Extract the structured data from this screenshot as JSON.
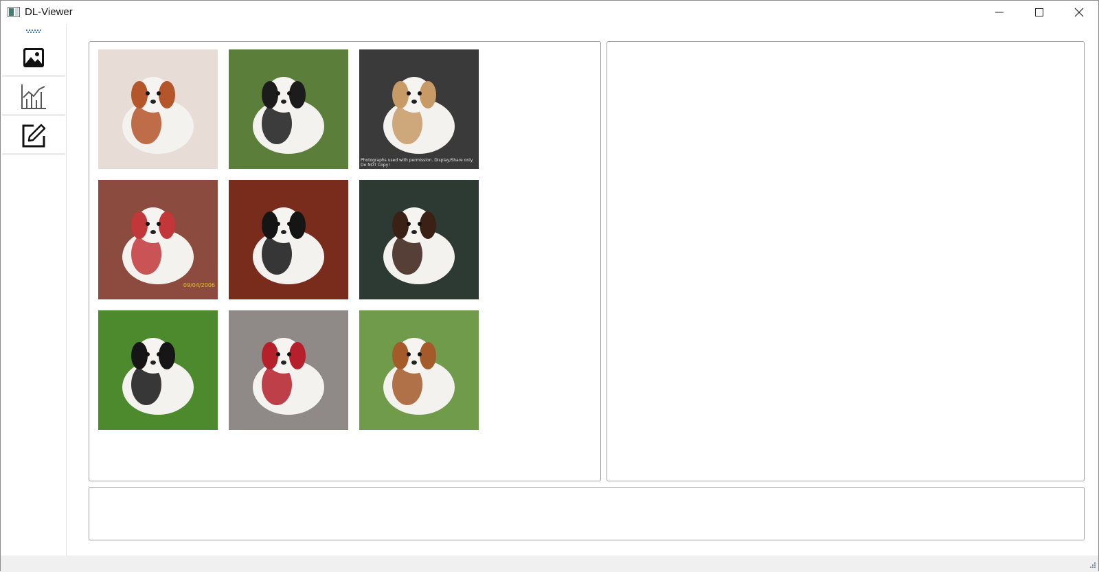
{
  "window": {
    "title": "DL-Viewer",
    "app_icon": "dl-viewer-app-icon",
    "controls": {
      "minimize_icon": "minimize-icon",
      "maximize_icon": "maximize-icon",
      "close_icon": "close-icon"
    }
  },
  "sidebar": {
    "grip_icon": "dotted-grip-icon",
    "items": [
      {
        "id": "images",
        "icon": "image-icon"
      },
      {
        "id": "statistics",
        "icon": "bar-line-chart-icon"
      },
      {
        "id": "edit",
        "icon": "edit-pencil-icon"
      }
    ]
  },
  "gallery": {
    "thumbnails": [
      {
        "subject": "dog-photo",
        "colors": [
          "#e8dcd6",
          "#b5552a"
        ]
      },
      {
        "subject": "dog-photo",
        "colors": [
          "#5b7f3b",
          "#1c1c1c"
        ]
      },
      {
        "subject": "dog-photo",
        "colors": [
          "#3a3a3a",
          "#c79a66"
        ],
        "caption": "Photographs used with permission. Display/Share only. Do NOT Copy!"
      },
      {
        "subject": "dog-photo",
        "colors": [
          "#8c4b3f",
          "#c2373a"
        ],
        "caption": "09/04/2006"
      },
      {
        "subject": "dog-photo",
        "colors": [
          "#7a2c1c",
          "#151515"
        ]
      },
      {
        "subject": "dog-photo",
        "colors": [
          "#2d3a33",
          "#3a2015"
        ]
      },
      {
        "subject": "dog-photo",
        "colors": [
          "#4d8a2e",
          "#161616"
        ]
      },
      {
        "subject": "dog-photo",
        "colors": [
          "#8f8a88",
          "#b5202a"
        ]
      },
      {
        "subject": "dog-photo",
        "colors": [
          "#6f9b4b",
          "#a55a2a"
        ]
      }
    ]
  },
  "detail_panel": {},
  "bottom_panel": {},
  "statusbar": {
    "resize_grip_icon": "resize-grip-icon"
  }
}
